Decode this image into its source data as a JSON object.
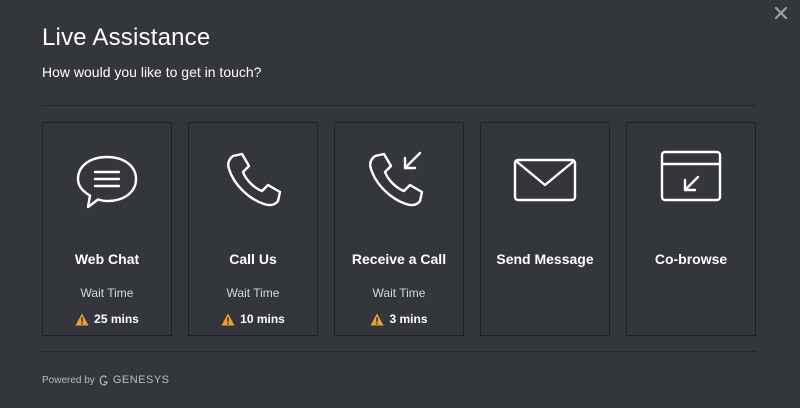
{
  "dialog": {
    "title": "Live Assistance",
    "subtitle": "How would you like to get in touch?",
    "close_icon": "close-icon"
  },
  "options": [
    {
      "label": "Web Chat",
      "icon": "chat-bubble-icon",
      "wait_label": "Wait Time",
      "wait_value": "25 mins",
      "status_icon": "warning-icon"
    },
    {
      "label": "Call Us",
      "icon": "phone-icon",
      "wait_label": "Wait Time",
      "wait_value": "10 mins",
      "status_icon": "warning-icon"
    },
    {
      "label": "Receive a Call",
      "icon": "phone-incoming-icon",
      "wait_label": "Wait Time",
      "wait_value": "3 mins",
      "status_icon": "warning-icon"
    },
    {
      "label": "Send Message",
      "icon": "envelope-icon"
    },
    {
      "label": "Co-browse",
      "icon": "cobrowse-icon"
    }
  ],
  "footer": {
    "powered_by": "Powered by",
    "brand": "GENESYS"
  },
  "colors": {
    "background": "#33373b",
    "warning": "#f0a030",
    "text": "#ffffff"
  }
}
